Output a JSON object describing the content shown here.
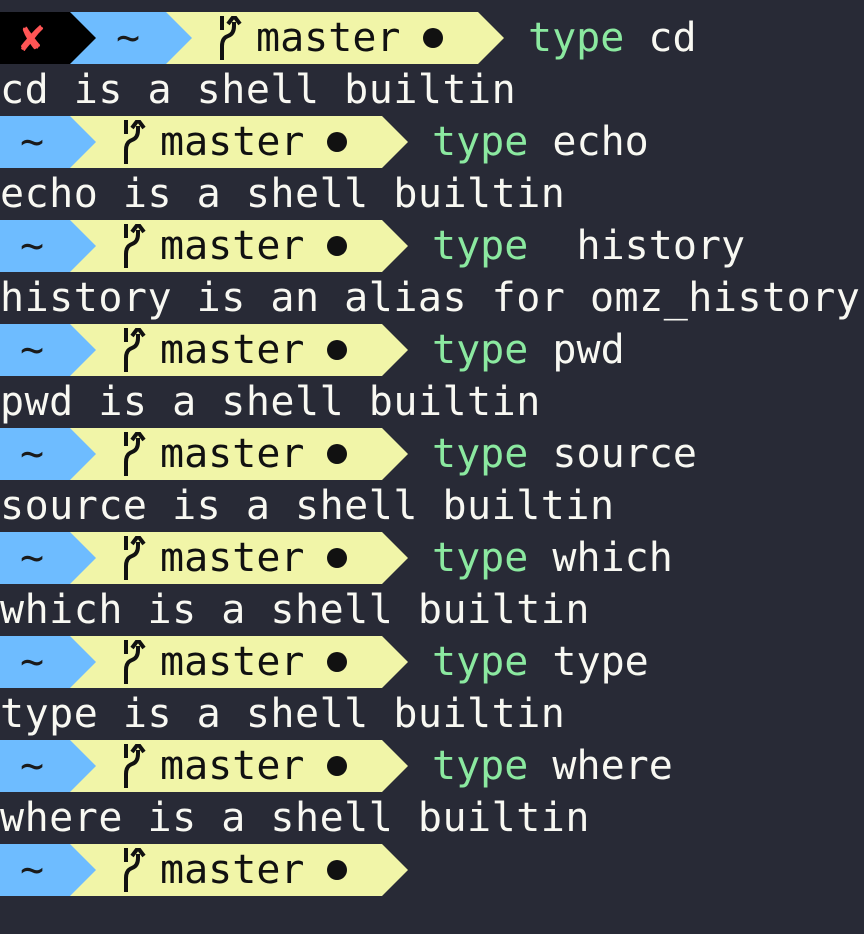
{
  "colors": {
    "background": "#282a36",
    "foreground": "#f8f8f2",
    "error": "#ff5555",
    "dir_segment": "#6ebcff",
    "git_segment": "#f1f5a8",
    "command_keyword": "#8be9a0"
  },
  "prompt": {
    "error_symbol": "✘",
    "dir": "~",
    "branch": "master",
    "branch_icon": "git-branch-icon",
    "dirty_icon": "dirty-dot-icon"
  },
  "lines": [
    {
      "kind": "prompt",
      "error": true,
      "keyword": "type",
      "arg": "cd"
    },
    {
      "kind": "output",
      "text": "cd is a shell builtin"
    },
    {
      "kind": "prompt",
      "error": false,
      "keyword": "type",
      "arg": "echo"
    },
    {
      "kind": "output",
      "text": "echo is a shell builtin"
    },
    {
      "kind": "prompt",
      "error": false,
      "keyword": "type",
      "arg": " history"
    },
    {
      "kind": "output",
      "text": "history is an alias for omz_history"
    },
    {
      "kind": "prompt",
      "error": false,
      "keyword": "type",
      "arg": "pwd"
    },
    {
      "kind": "output",
      "text": "pwd is a shell builtin"
    },
    {
      "kind": "prompt",
      "error": false,
      "keyword": "type",
      "arg": "source"
    },
    {
      "kind": "output",
      "text": "source is a shell builtin"
    },
    {
      "kind": "prompt",
      "error": false,
      "keyword": "type",
      "arg": "which"
    },
    {
      "kind": "output",
      "text": "which is a shell builtin"
    },
    {
      "kind": "prompt",
      "error": false,
      "keyword": "type",
      "arg": "type"
    },
    {
      "kind": "output",
      "text": "type is a shell builtin"
    },
    {
      "kind": "prompt",
      "error": false,
      "keyword": "type",
      "arg": "where"
    },
    {
      "kind": "output",
      "text": "where is a shell builtin"
    },
    {
      "kind": "prompt",
      "error": false,
      "keyword": "",
      "arg": ""
    }
  ]
}
